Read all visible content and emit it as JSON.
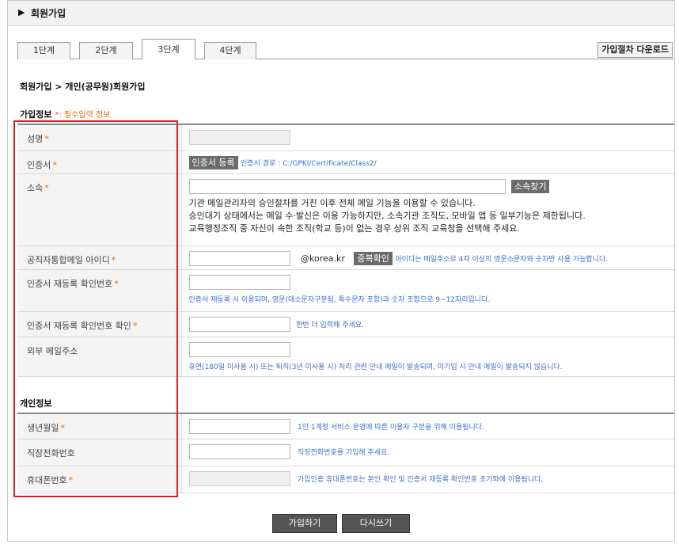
{
  "page": {
    "title": "회원가입",
    "breadcrumb": "회원가입 > 개인(공무원)회원가입"
  },
  "tabs": [
    {
      "label": "1단계"
    },
    {
      "label": "2단계"
    },
    {
      "label": "3단계"
    },
    {
      "label": "4단계"
    }
  ],
  "active_tab": "3단계",
  "download_button": "가입절차 다운로드",
  "sections": {
    "join_info": {
      "title": "가입정보",
      "required_note": "*: 필수입력 정보"
    },
    "personal_info": {
      "title": "개인정보"
    }
  },
  "required_mark": "*",
  "fields": {
    "name": {
      "label": "성명"
    },
    "certificate": {
      "label": "인증서",
      "button": "인증서 등록",
      "path_hint": "인증서 경로 : C:/GPKI/Certificate/Class2/"
    },
    "affiliation": {
      "label": "소속",
      "button": "소속찾기",
      "desc1": "기관 메일관리자의 승인절차를 거친 이후 전체 메일 기능을 이용할 수 있습니다.",
      "desc2": "승인대기 상태에서는 메일 수·발신은 이용 가능하지만, 소속기관 조직도, 모바일 앱 등 일부기능은 제한됩니다.",
      "desc3": "교육행정조직 중 자신이 속한 조직(학교 등)이 없는 경우 상위 조직 교육청을 선택해 주세요."
    },
    "mail_id": {
      "label": "공직자통합메일 아이디",
      "suffix": "@korea.kr",
      "button": "중복확인",
      "hint": "아이디는 메일주소로 4자 이상의 영문소문자와 숫자만 사용 가능합니다."
    },
    "reissue_code": {
      "label": "인증서 재등록 확인번호",
      "hint": "인증서 재등록 시 이용되며, 영문(대소문자구분됨, 특수문자 포함)과 숫자 조합으로 9~12자리입니다."
    },
    "reissue_confirm": {
      "label": "인증서 재등록 확인번호 확인",
      "hint": "한번 더 입력해 주세요."
    },
    "external_mail": {
      "label": "외부 메일주소",
      "hint": "휴면(180일 미사용 시) 또는 퇴직(3년 미사용 시) 처리 관련 안내 메일이 발송되며, 미기입 시 안내 메일이 발송되지 않습니다."
    },
    "birth": {
      "label": "생년월일",
      "hint": "1인 1계정 서비스 운영에 따른 이용자 구분을 위해 이용됩니다."
    },
    "office_phone": {
      "label": "직장전화번호",
      "hint": "직장전화번호를 기입해 주세요."
    },
    "mobile": {
      "label": "휴대폰번호",
      "hint": "가입인증 휴대폰번호는 본인 확인 및 인증서 재등록 확인번호 초기화에 이용됩니다."
    }
  },
  "buttons": {
    "submit": "가입하기",
    "reset": "다시쓰기"
  },
  "colors": {
    "required": "#e06a14",
    "hint": "#3a6fd0",
    "highlight_box": "#e02020"
  }
}
